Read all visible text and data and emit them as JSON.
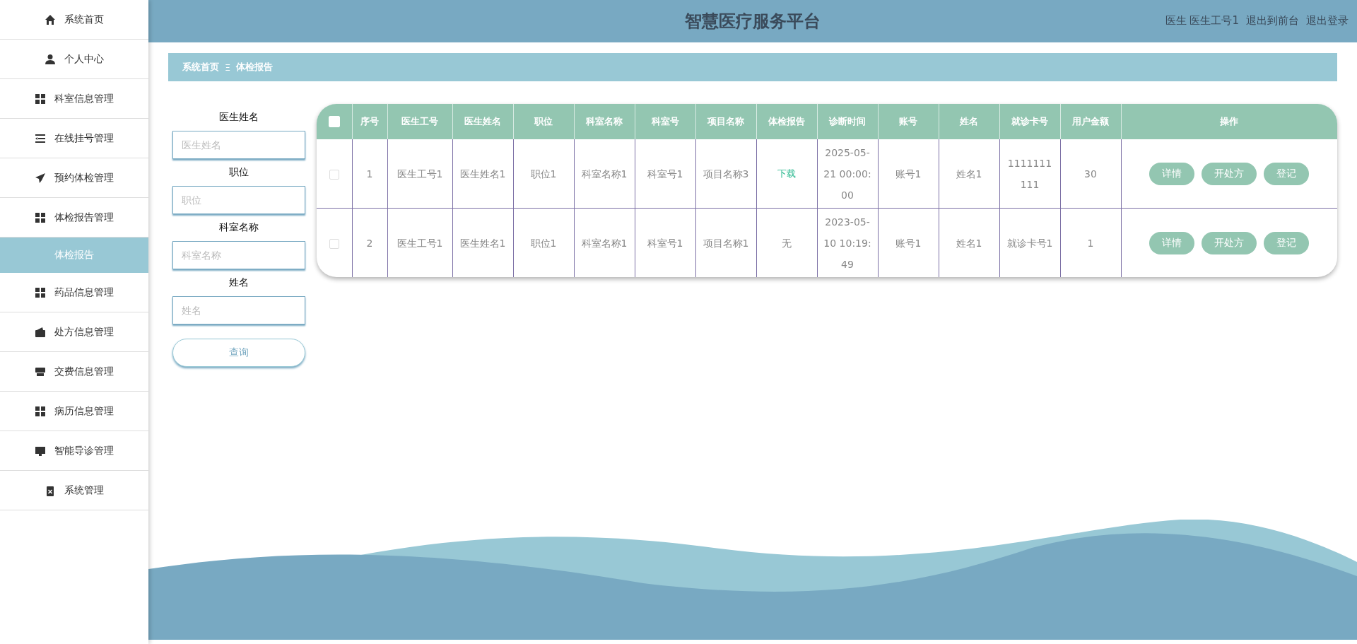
{
  "sidebar": {
    "items": [
      {
        "label": "系统首页",
        "kind": "home",
        "selected": false
      },
      {
        "label": "个人中心",
        "kind": "user",
        "selected": false
      },
      {
        "label": "科室信息管理",
        "kind": "grid",
        "selected": false
      },
      {
        "label": "在线挂号管理",
        "kind": "list",
        "selected": false
      },
      {
        "label": "预约体检管理",
        "kind": "plane",
        "selected": false
      },
      {
        "label": "体检报告管理",
        "kind": "grid",
        "selected": false,
        "expanded": true,
        "children": [
          {
            "label": "体检报告",
            "selected": true
          }
        ]
      },
      {
        "label": "药品信息管理",
        "kind": "grid",
        "selected": false
      },
      {
        "label": "处方信息管理",
        "kind": "wallet",
        "selected": false
      },
      {
        "label": "交费信息管理",
        "kind": "store",
        "selected": false
      },
      {
        "label": "病历信息管理",
        "kind": "grid",
        "selected": false
      },
      {
        "label": "智能导诊管理",
        "kind": "monitor",
        "selected": false
      },
      {
        "label": "系统管理",
        "kind": "clipboard",
        "selected": false
      }
    ]
  },
  "header": {
    "title": "智慧医疗服务平台",
    "user_links": [
      "医生 医生工号1",
      "退出到前台",
      "退出登录"
    ]
  },
  "breadcrumb": {
    "items": [
      "系统首页",
      "体检报告"
    ],
    "separator": "Ξ"
  },
  "filters": {
    "fields": [
      {
        "label": "医生姓名",
        "placeholder": "医生姓名"
      },
      {
        "label": "职位",
        "placeholder": "职位"
      },
      {
        "label": "科室名称",
        "placeholder": "科室名称"
      },
      {
        "label": "姓名",
        "placeholder": "姓名"
      }
    ],
    "search_button": "查询"
  },
  "table": {
    "select_all_checked": false,
    "columns": [
      "序号",
      "医生工号",
      "医生姓名",
      "职位",
      "科室名称",
      "科室号",
      "项目名称",
      "体检报告",
      "诊断时间",
      "账号",
      "姓名",
      "就诊卡号",
      "用户金额",
      "操作"
    ],
    "rows": [
      {
        "checked": false,
        "cells": [
          "1",
          "医生工号1",
          "医生姓名1",
          "职位1",
          "科室名称1",
          "科室号1",
          "项目名称3"
        ],
        "report": {
          "kind": "link",
          "text": "下载"
        },
        "rest": [
          "2025-05-21 00:00:00",
          "账号1",
          "姓名1",
          "1111111111",
          "30"
        ],
        "actions": [
          "详情",
          "开处方",
          "登记"
        ]
      },
      {
        "checked": false,
        "cells": [
          "2",
          "医生工号1",
          "医生姓名1",
          "职位1",
          "科室名称1",
          "科室号1",
          "项目名称1"
        ],
        "report": {
          "kind": "text",
          "text": "无"
        },
        "rest": [
          "2023-05-10 10:19:49",
          "账号1",
          "姓名1",
          "就诊卡号1",
          "1"
        ],
        "actions": [
          "详情",
          "开处方",
          "登记"
        ]
      }
    ]
  }
}
